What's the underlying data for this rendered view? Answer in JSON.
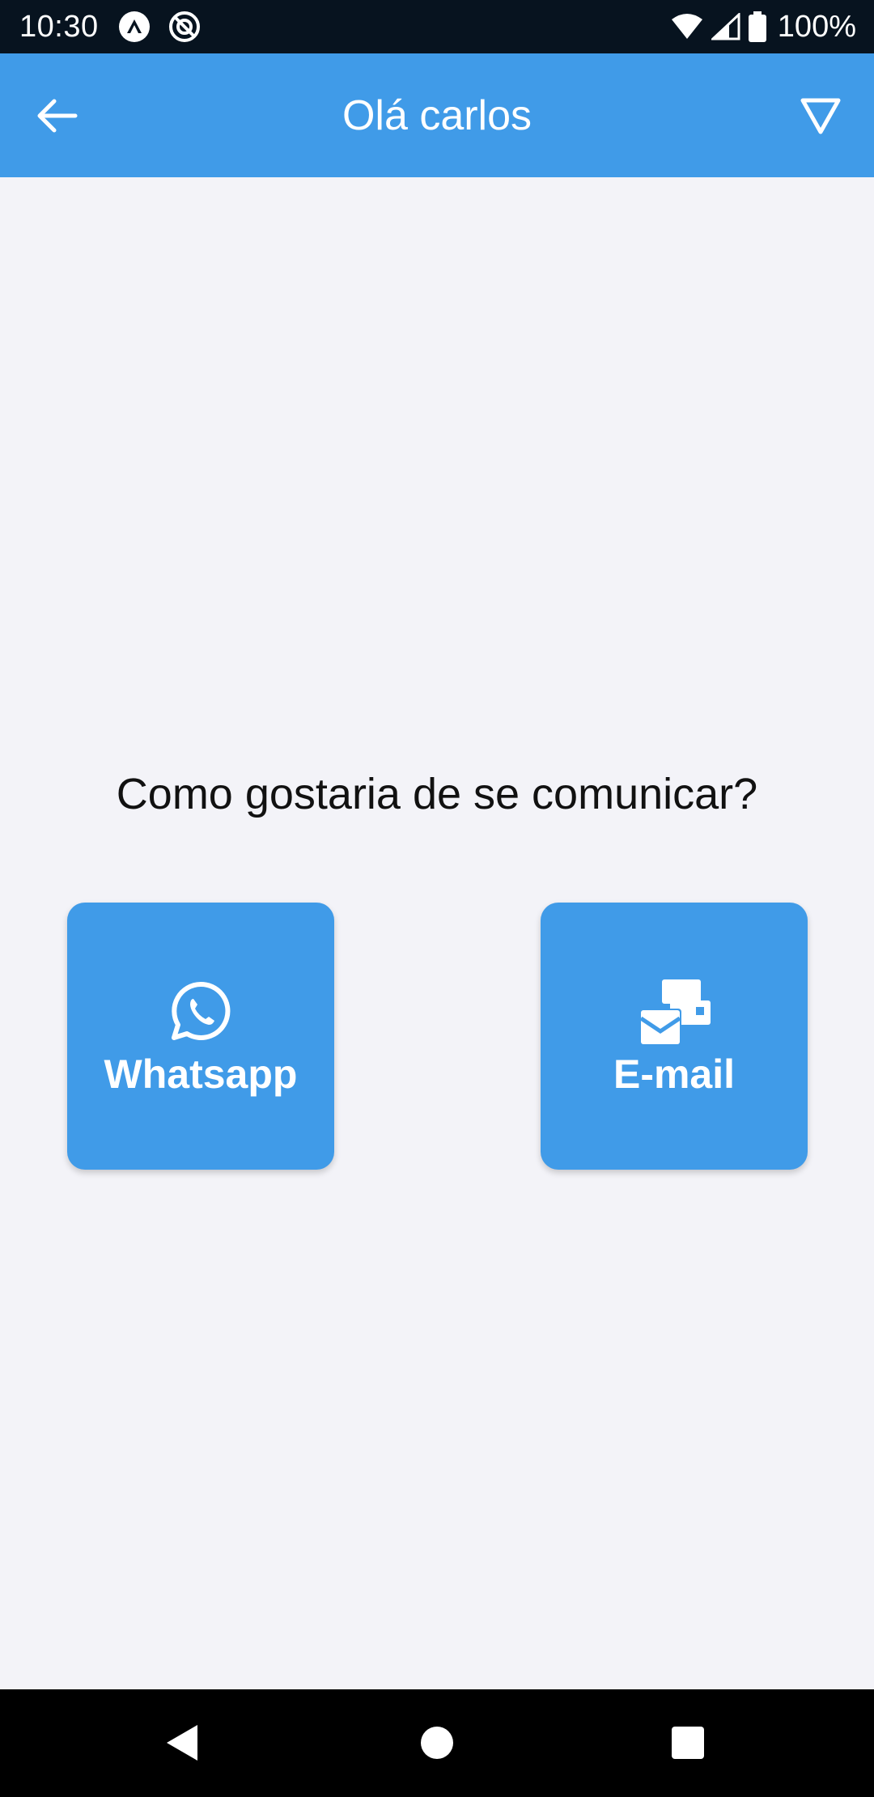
{
  "status_bar": {
    "time": "10:30",
    "battery": "100%",
    "icons": [
      "expo-notification-icon",
      "sync-notification-icon",
      "wifi-icon",
      "signal-icon",
      "battery-icon"
    ]
  },
  "app_bar": {
    "title": "Olá carlos",
    "back_icon": "arrow-left-icon",
    "filter_icon": "filter-triangle-icon",
    "background_color": "#409be8"
  },
  "main": {
    "question": "Como gostaria de se comunicar?",
    "options": [
      {
        "label": "Whatsapp",
        "icon": "whatsapp-icon"
      },
      {
        "label": "E-mail",
        "icon": "mail-bulk-icon"
      }
    ]
  },
  "nav_bar": {
    "buttons": [
      "back-triangle-icon",
      "home-circle-icon",
      "recents-square-icon"
    ]
  },
  "colors": {
    "accent": "#409be8",
    "background": "#f3f3f8",
    "status_bar": "#07131f"
  }
}
